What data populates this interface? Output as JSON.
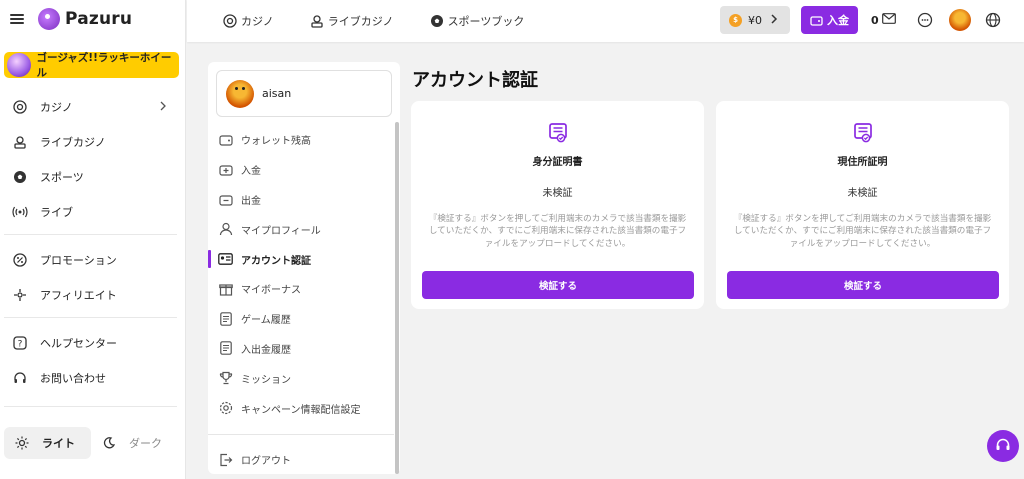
{
  "brand": {
    "name": "Pazuru"
  },
  "sidebar": {
    "promo_label": "ゴージャズ!!ラッキーホイール",
    "group1": [
      {
        "label": "カジノ",
        "icon": "casino-chip-icon",
        "has_chevron": true
      },
      {
        "label": "ライブカジノ",
        "icon": "live-dealer-icon"
      },
      {
        "label": "スポーツ",
        "icon": "soccer-ball-icon"
      },
      {
        "label": "ライブ",
        "icon": "broadcast-icon"
      }
    ],
    "group2": [
      {
        "label": "プロモーション",
        "icon": "promotion-icon"
      },
      {
        "label": "アフィリエイト",
        "icon": "affiliate-icon"
      }
    ],
    "group3": [
      {
        "label": "ヘルプセンター",
        "icon": "help-icon"
      },
      {
        "label": "お問い合わせ",
        "icon": "headset-icon"
      }
    ],
    "theme": {
      "light": "ライト",
      "dark": "ダーク"
    }
  },
  "header": {
    "links": [
      {
        "label": "カジノ",
        "icon": "casino-chip-icon"
      },
      {
        "label": "ライブカジノ",
        "icon": "live-dealer-icon"
      },
      {
        "label": "スポーツブック",
        "icon": "soccer-ball-icon"
      }
    ],
    "balance": "¥0",
    "deposit_label": "入金",
    "mail_count": "0"
  },
  "account_menu": {
    "username": "aisan",
    "items": [
      {
        "label": "ウォレット残高",
        "icon": "wallet-icon"
      },
      {
        "label": "入金",
        "icon": "deposit-icon"
      },
      {
        "label": "出金",
        "icon": "withdraw-icon"
      },
      {
        "label": "マイプロフィール",
        "icon": "user-icon"
      },
      {
        "label": "アカウント認証",
        "icon": "id-card-icon",
        "active": true
      },
      {
        "label": "マイボーナス",
        "icon": "gift-icon"
      },
      {
        "label": "ゲーム履歴",
        "icon": "document-icon"
      },
      {
        "label": "入出金履歴",
        "icon": "document-icon"
      },
      {
        "label": "ミッション",
        "icon": "trophy-icon"
      },
      {
        "label": "キャンペーン情報配信設定",
        "icon": "gear-icon"
      }
    ],
    "logout": "ログアウト"
  },
  "main": {
    "title": "アカウント認証",
    "cards": [
      {
        "title": "身分証明書",
        "status": "未検証",
        "description": "『検証する』ボタンを押してご利用端末のカメラで該当書類を撮影していただくか、すでにご利用端末に保存された該当書類の電子ファイルをアップロードしてください。",
        "button": "検証する"
      },
      {
        "title": "現住所証明",
        "status": "未検証",
        "description": "『検証する』ボタンを押してご利用端末のカメラで該当書類を撮影していただくか、すでにご利用端末に保存された該当書類の電子ファイルをアップロードしてください。",
        "button": "検証する"
      }
    ]
  },
  "colors": {
    "accent": "#8a2be2",
    "promo": "#ffcc00",
    "coin": "#f4a024"
  }
}
